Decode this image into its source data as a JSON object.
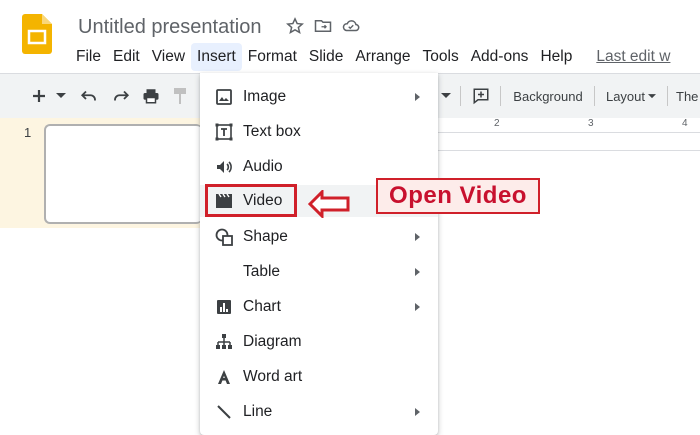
{
  "app": {
    "title": "Untitled presentation",
    "last_edit": "Last edit w"
  },
  "menubar": [
    "File",
    "Edit",
    "View",
    "Insert",
    "Format",
    "Slide",
    "Arrange",
    "Tools",
    "Add-ons",
    "Help"
  ],
  "active_menu": "Insert",
  "toolbar": {
    "background_label": "Background",
    "layout_label": "Layout",
    "theme_label": "The"
  },
  "ruler_ticks": [
    "2",
    "3",
    "4"
  ],
  "slides": [
    {
      "number": "1"
    }
  ],
  "insert_menu": [
    {
      "label": "Image",
      "icon": "image-icon",
      "submenu": true
    },
    {
      "label": "Text box",
      "icon": "text-box-icon",
      "submenu": false
    },
    {
      "label": "Audio",
      "icon": "audio-icon",
      "submenu": false
    },
    {
      "label": "Video",
      "icon": "video-icon",
      "submenu": false,
      "highlighted": true
    },
    {
      "label": "Shape",
      "icon": "shape-icon",
      "submenu": true
    },
    {
      "label": "Table",
      "icon": "",
      "submenu": true
    },
    {
      "label": "Chart",
      "icon": "chart-icon",
      "submenu": true
    },
    {
      "label": "Diagram",
      "icon": "diagram-icon",
      "submenu": false
    },
    {
      "label": "Word art",
      "icon": "word-art-icon",
      "submenu": false
    },
    {
      "label": "Line",
      "icon": "line-icon",
      "submenu": true
    }
  ],
  "annotation": {
    "label": "Open Video",
    "color": "#d0202a"
  },
  "colors": {
    "logo": "#f4b400",
    "menu_active_bg": "#e8f0fe",
    "toolbar_bg": "#f1f3f4",
    "filmstrip_bg": "#fdf5e1"
  }
}
